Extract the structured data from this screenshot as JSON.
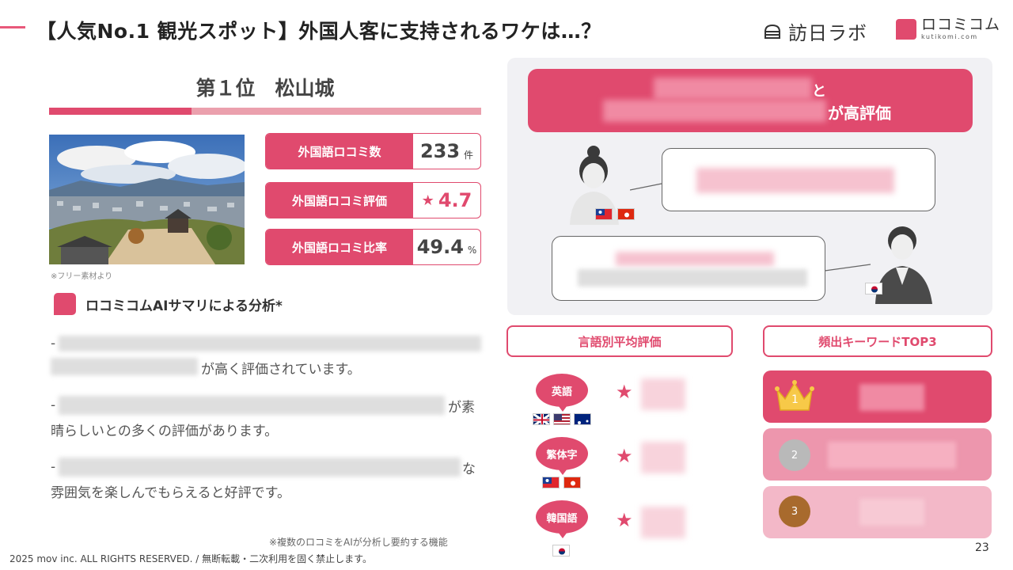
{
  "header": {
    "title": "【人気No.1 観光スポット】外国人客に支持されるワケは…？",
    "logo_houni": "訪日ラボ",
    "logo_kutikomi": "ロコミコム",
    "logo_kutikomi_sub": "kutikomi.com"
  },
  "left": {
    "rank_title": "第１位　松山城",
    "photo_caption": "※フリー素材より",
    "stats": [
      {
        "label": "外国語ロコミ数",
        "value": "233",
        "unit": "件"
      },
      {
        "label": "外国語ロコミ評価",
        "value": "4.7",
        "star": "★"
      },
      {
        "label": "外国語ロコミ比率",
        "value": "49.4",
        "unit": "%"
      }
    ],
    "ai_title": "ロコミコムAIサマリによる分析*",
    "summary": [
      {
        "dash": "-",
        "tail": "が高く評価されています。"
      },
      {
        "dash": "-",
        "tail": "が素",
        "line2": "晴らしいとの多くの評価があります。"
      },
      {
        "dash": "-",
        "tail": "な",
        "line2": "雰囲気を楽しんでもらえると好評です。"
      }
    ],
    "footnote": "※複数のロコミをAIが分析し要約する機能"
  },
  "right": {
    "banner_word1": "と",
    "banner_word2": "が高評価",
    "lang_section": "言語別平均評価",
    "kw_section": "頻出キーワードTOP3",
    "languages": [
      {
        "label": "英語",
        "star": "★"
      },
      {
        "label": "繁体字",
        "star": "★"
      },
      {
        "label": "韓国語",
        "star": "★"
      }
    ],
    "ranks": [
      "1",
      "2",
      "3"
    ]
  },
  "footer": {
    "copyright": "2025 mov inc. ALL RIGHTS RESERVED. / 無断転載・二次利用を固く禁止します。",
    "page": "23"
  },
  "colors": {
    "accent": "#e04a6e",
    "accent_light": "#eba0ad",
    "panel": "#f1f1f4"
  }
}
